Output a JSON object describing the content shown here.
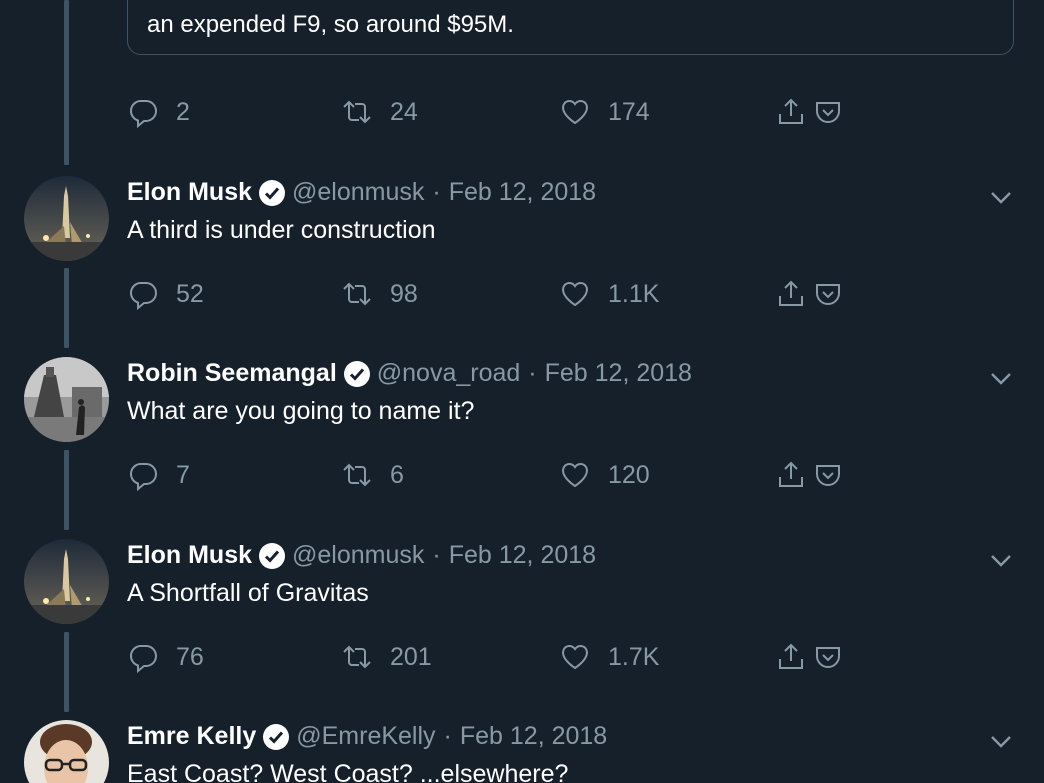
{
  "quote": {
    "text": "an expended F9, so around $95M."
  },
  "top_actions": {
    "replies": "2",
    "retweets": "24",
    "likes": "174"
  },
  "tweets": [
    {
      "name": "Elon Musk",
      "handle": "@elonmusk",
      "sep": "·",
      "date": "Feb 12, 2018",
      "text": "A third is under construction",
      "replies": "52",
      "retweets": "98",
      "likes": "1.1K"
    },
    {
      "name": "Robin Seemangal",
      "handle": "@nova_road",
      "sep": "·",
      "date": "Feb 12, 2018",
      "text": "What are you going to name it?",
      "replies": "7",
      "retweets": "6",
      "likes": "120"
    },
    {
      "name": "Elon Musk",
      "handle": "@elonmusk",
      "sep": "·",
      "date": "Feb 12, 2018",
      "text": "A Shortfall of Gravitas",
      "replies": "76",
      "retweets": "201",
      "likes": "1.7K"
    },
    {
      "name": "Emre Kelly",
      "handle": "@EmreKelly",
      "sep": "·",
      "date": "Feb 12, 2018",
      "text": "East Coast? West Coast? ...elsewhere?"
    }
  ],
  "icons": {
    "reply": "reply-icon",
    "retweet": "retweet-icon",
    "like": "like-icon",
    "share": "share-icon",
    "pocket": "pocket-icon",
    "verified": "verified-badge-icon",
    "more": "chevron-down-icon"
  },
  "colors": {
    "background": "#15202b",
    "muted": "#8899a6",
    "thread": "#3d5466",
    "text": "#ffffff"
  }
}
